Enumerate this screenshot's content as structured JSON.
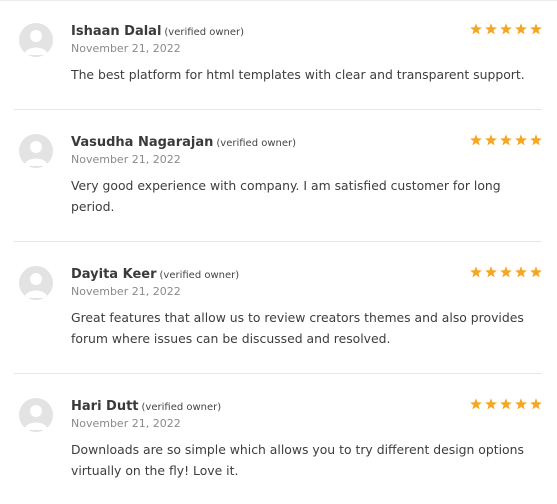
{
  "colors": {
    "star": "#f5a623",
    "avatar_bg": "#e3e3e3",
    "avatar_fg": "#ffffff"
  },
  "reviews": [
    {
      "author": "Ishaan Dalal",
      "owner_tag": "(verified owner)",
      "date": "November 21, 2022",
      "rating": 5,
      "text": "The best platform for html templates with clear and transparent support."
    },
    {
      "author": "Vasudha Nagarajan",
      "owner_tag": "(verified owner)",
      "date": "November 21, 2022",
      "rating": 5,
      "text": "Very good experience with company. I am satisfied customer for long period."
    },
    {
      "author": "Dayita Keer",
      "owner_tag": "(verified owner)",
      "date": "November 21, 2022",
      "rating": 5,
      "text": "Great features that allow us to review creators themes and also provides forum where issues can be discussed and resolved."
    },
    {
      "author": "Hari Dutt",
      "owner_tag": "(verified owner)",
      "date": "November 21, 2022",
      "rating": 5,
      "text": "Downloads are so simple which allows you to try different design options virtually on the fly! Love it."
    }
  ]
}
